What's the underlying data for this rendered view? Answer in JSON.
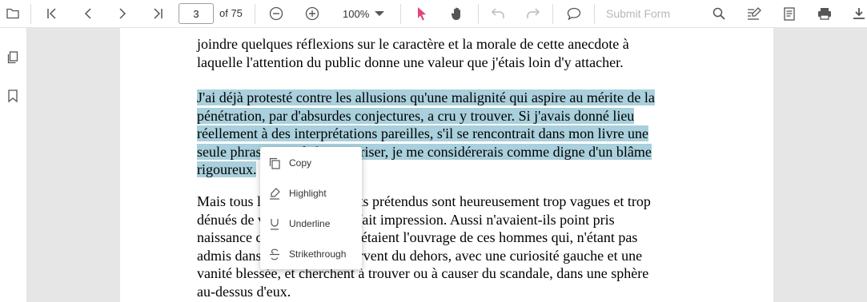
{
  "toolbar": {
    "page_current": "3",
    "page_total_label": "of 75",
    "zoom_value": "100%",
    "submit_form_label": "Submit Form"
  },
  "document": {
    "paragraph1_lines": [
      "joindre quelques réflexions sur le caractère et la morale de cette anecdote à",
      "laquelle l'attention du public donne une valeur que j'étais loin d'y attacher."
    ],
    "paragraph2_lines": [
      "J'ai déjà protesté contre les allusions qu'une malignité qui aspire au mérite de la",
      "pénétration, par d'absurdes conjectures, a cru y trouver. Si j'avais donné lieu",
      "réellement à des interprétations pareilles, s'il se rencontrait dans mon livre une",
      "seule phrase qui pût les autoriser, je me considérerais comme digne d'un blâme",
      "rigoureux."
    ],
    "paragraph3_lines": [
      "Mais tous les rapprochements prétendus sont heureusement trop vagues et trop",
      "dénués de vérité pour avoir fait impression. Aussi n'avaient-ils point pris",
      "naissance dans le public. Ils étaient l'ouvrage de ces hommes qui, n'étant pas",
      "admis dans le monde, l'observent du dehors, avec une curiosité gauche et une",
      "vanité blessée, et cherchent à trouver ou à causer du scandale, dans une sphère",
      "au-dessus d'eux."
    ]
  },
  "context_menu": {
    "items": [
      {
        "label": "Copy",
        "icon": "copy-icon"
      },
      {
        "label": "Highlight",
        "icon": "highlight-icon"
      },
      {
        "label": "Underline",
        "icon": "underline-icon"
      },
      {
        "label": "Strikethrough",
        "icon": "strikethrough-icon"
      }
    ]
  },
  "colors": {
    "selection_highlight": "#a9d0dc",
    "accent_pointer": "#e0457b",
    "viewer_background": "#e6e6e6"
  }
}
